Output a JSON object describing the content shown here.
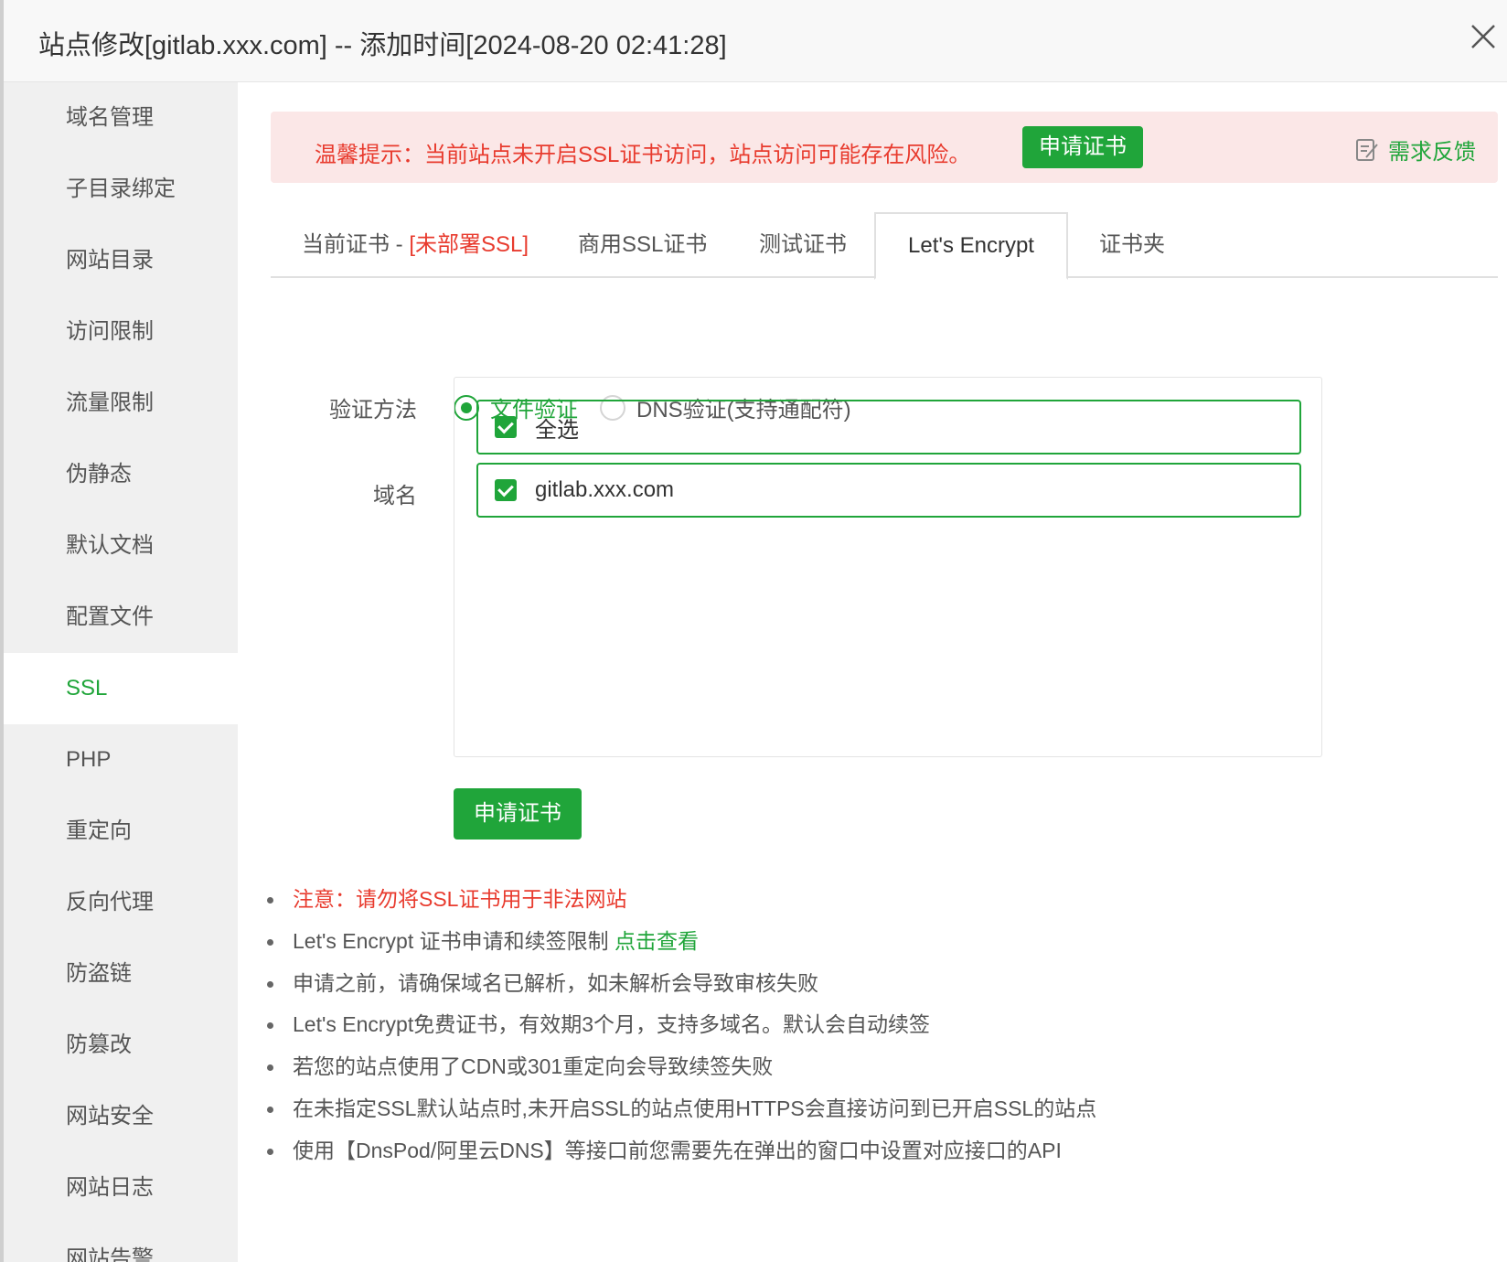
{
  "dialog": {
    "title": "站点修改[gitlab.xxx.com] -- 添加时间[2024-08-20 02:41:28]"
  },
  "sidebar": {
    "items": [
      {
        "label": "域名管理"
      },
      {
        "label": "子目录绑定"
      },
      {
        "label": "网站目录"
      },
      {
        "label": "访问限制"
      },
      {
        "label": "流量限制"
      },
      {
        "label": "伪静态"
      },
      {
        "label": "默认文档"
      },
      {
        "label": "配置文件"
      },
      {
        "label": "SSL"
      },
      {
        "label": "PHP"
      },
      {
        "label": "重定向"
      },
      {
        "label": "反向代理"
      },
      {
        "label": "防盗链"
      },
      {
        "label": "防篡改"
      },
      {
        "label": "网站安全"
      },
      {
        "label": "网站日志"
      },
      {
        "label": "网站告警"
      }
    ],
    "active": "SSL"
  },
  "alert": {
    "text": "温馨提示：当前站点未开启SSL证书访问，站点访问可能存在风险。",
    "button": "申请证书",
    "feedback": "需求反馈"
  },
  "tabs": {
    "current_prefix": "当前证书 - ",
    "current_status": "[未部署SSL]",
    "commercial": "商用SSL证书",
    "test": "测试证书",
    "letsencrypt": "Let's Encrypt",
    "folder": "证书夹"
  },
  "form": {
    "method_label": "验证方法",
    "method_file": "文件验证",
    "method_dns": "DNS验证(支持通配符)",
    "domain_label": "域名",
    "select_all": "全选",
    "domains": [
      "gitlab.xxx.com"
    ],
    "apply_button": "申请证书"
  },
  "notes": {
    "n1": "注意：请勿将SSL证书用于非法网站",
    "n2_text": "Let's Encrypt 证书申请和续签限制 ",
    "n2_link": "点击查看",
    "n3": "申请之前，请确保域名已解析，如未解析会导致审核失败",
    "n4": "Let's Encrypt免费证书，有效期3个月，支持多域名。默认会自动续签",
    "n5": "若您的站点使用了CDN或301重定向会导致续签失败",
    "n6": "在未指定SSL默认站点时,未开启SSL的站点使用HTTPS会直接访问到已开启SSL的站点",
    "n7": "使用【DnsPod/阿里云DNS】等接口前您需要先在弹出的窗口中设置对应接口的API"
  },
  "colors": {
    "accent": "#20a53a",
    "warning": "#e83b2e",
    "alert_bg": "#fbe7e7",
    "sidebar_bg": "#f0f0f0"
  }
}
